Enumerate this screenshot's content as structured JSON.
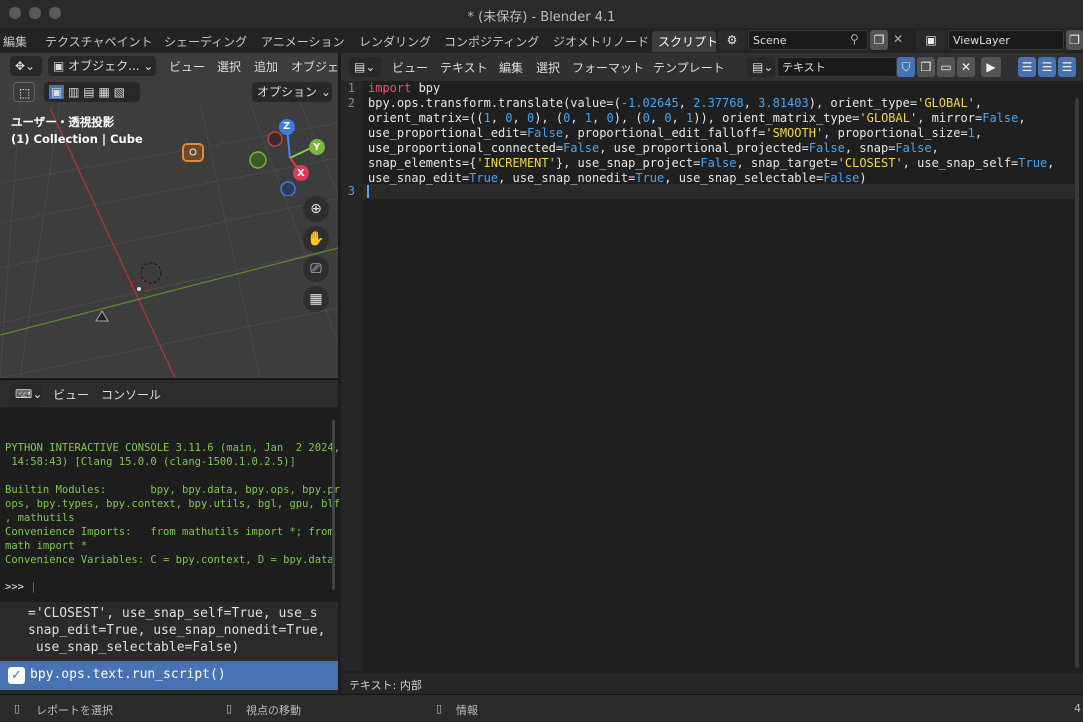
{
  "window": {
    "title": "* (未保存) - Blender 4.1"
  },
  "workspace_tabs": [
    "編集",
    "テクスチャペイント",
    "シェーディング",
    "アニメーション",
    "レンダリング",
    "コンポジティング",
    "ジオメトリノード",
    "スクリプト"
  ],
  "active_tab": "スクリプト",
  "scene": {
    "name": "Scene",
    "view_layer": "ViewLayer"
  },
  "viewport": {
    "mode": "オブジェク...",
    "menus": [
      "ビュー",
      "選択",
      "追加",
      "オブジェ"
    ],
    "options_label": "オプション",
    "view_name": "ユーザー・透視投影",
    "collection_info": "(1) Collection | Cube",
    "axes": {
      "x": "X",
      "y": "Y",
      "z": "Z"
    }
  },
  "console": {
    "menus": [
      "ビュー",
      "コンソール"
    ],
    "lines": [
      "PYTHON INTERACTIVE CONSOLE 3.11.6 (main, Jan  2 2024,",
      " 14:58:43) [Clang 15.0.0 (clang-1500.1.0.2.5)]",
      "",
      "Builtin Modules:       bpy, bpy.data, bpy.ops, bpy.pr",
      "ops, bpy.types, bpy.context, bpy.utils, bgl, gpu, blf",
      ", mathutils",
      "Convenience Imports:   from mathutils import *; from",
      "math import *",
      "Convenience Variables: C = bpy.context, D = bpy.data"
    ],
    "prompt": ">>> "
  },
  "info": {
    "lines": [
      "='CLOSEST', use_snap_self=True, use_s",
      "snap_edit=True, use_snap_nonedit=True,",
      " use_snap_selectable=False)"
    ],
    "selected_op": "bpy.ops.text.run_script()"
  },
  "text_editor": {
    "menus": [
      "ビュー",
      "テキスト",
      "編集",
      "選択",
      "フォーマット",
      "テンプレート"
    ],
    "datablock_name": "テキスト",
    "line_numbers": [
      "1",
      "2",
      "3"
    ],
    "footer": "テキスト: 内部"
  },
  "status_bar": {
    "left": "レポートを選択",
    "middle": "視点の移動",
    "right": "情報",
    "version_suffix": "4"
  },
  "colors": {
    "accent_blue": "#4772b3",
    "keyword": "#ea4f6d",
    "string": "#f0d64a",
    "number": "#47a6ee"
  }
}
